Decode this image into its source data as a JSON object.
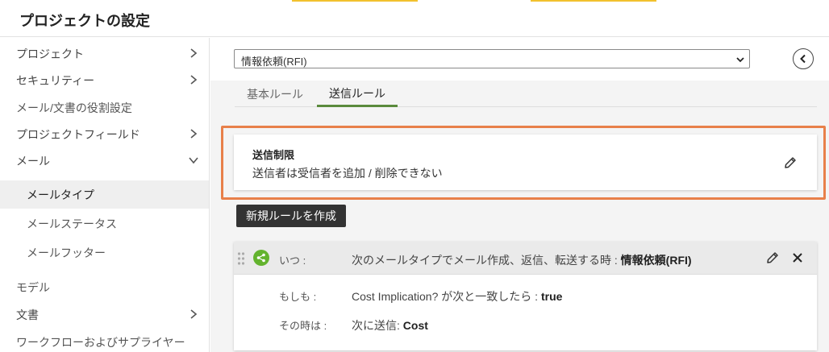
{
  "header": {
    "title": "プロジェクトの設定"
  },
  "sidebar": {
    "items": [
      {
        "label": "プロジェクト",
        "chevron": "right"
      },
      {
        "label": "セキュリティー",
        "chevron": "right"
      },
      {
        "label": "メール/文書の役割設定",
        "chevron": ""
      },
      {
        "label": "プロジェクトフィールド",
        "chevron": "right"
      },
      {
        "label": "メール",
        "chevron": "down"
      },
      {
        "label": "メールタイプ",
        "chevron": "",
        "sub": true,
        "active": true
      },
      {
        "label": "メールステータス",
        "chevron": "",
        "sub": true
      },
      {
        "label": "メールフッター",
        "chevron": "",
        "sub": true
      },
      {
        "label": "モデル",
        "chevron": ""
      },
      {
        "label": "文書",
        "chevron": "right"
      },
      {
        "label": "ワークフローおよびサプライヤー",
        "chevron": ""
      }
    ]
  },
  "main": {
    "select": {
      "value": "情報依頼(RFI)"
    },
    "tabs": [
      {
        "label": "基本ルール"
      },
      {
        "label": "送信ルール"
      }
    ],
    "restriction_card": {
      "title": "送信制限",
      "description": "送信者は受信者を追加 / 削除できない"
    },
    "new_rule_label": "新規ルールを作成",
    "rule": {
      "when_label": "いつ :",
      "when_text": "次のメールタイプでメール作成、返信、転送する時 :",
      "when_value": "情報依頼(RFI)",
      "if_label": "もしも :",
      "if_text": "Cost Implication? が次と一致したら :",
      "if_value": "true",
      "then_label": "その時は :",
      "then_text": "次に送信:",
      "then_value": "Cost"
    }
  },
  "colors": {
    "accent_yellow": "#f2c12e",
    "highlight_orange": "#e8804a",
    "tab_active_green": "#5a8a3c",
    "share_green": "#63b32e"
  }
}
